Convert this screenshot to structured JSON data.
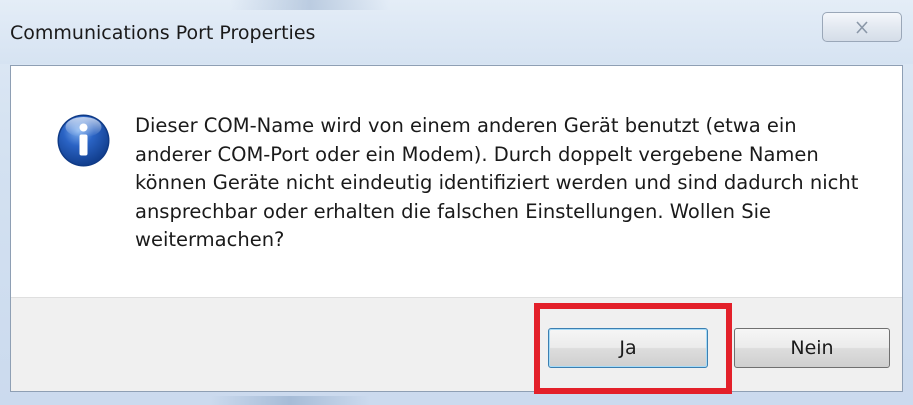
{
  "window": {
    "title": "Communications Port Properties",
    "close_icon": "close-icon"
  },
  "dialog": {
    "icon": "info-icon",
    "message": "Dieser COM-Name wird von einem anderen Gerät benutzt (etwa ein anderer COM-Port oder ein Modem). Durch doppelt vergebene Namen können Geräte nicht eindeutig identifiziert werden und sind dadurch nicht ansprechbar oder erhalten die falschen Einstellungen. Wollen Sie weitermachen?"
  },
  "buttons": {
    "yes_label": "Ja",
    "no_label": "Nein"
  },
  "colors": {
    "highlight": "#e3202a",
    "info_blue": "#1f56b3",
    "footer_bg": "#f0f0f0"
  }
}
